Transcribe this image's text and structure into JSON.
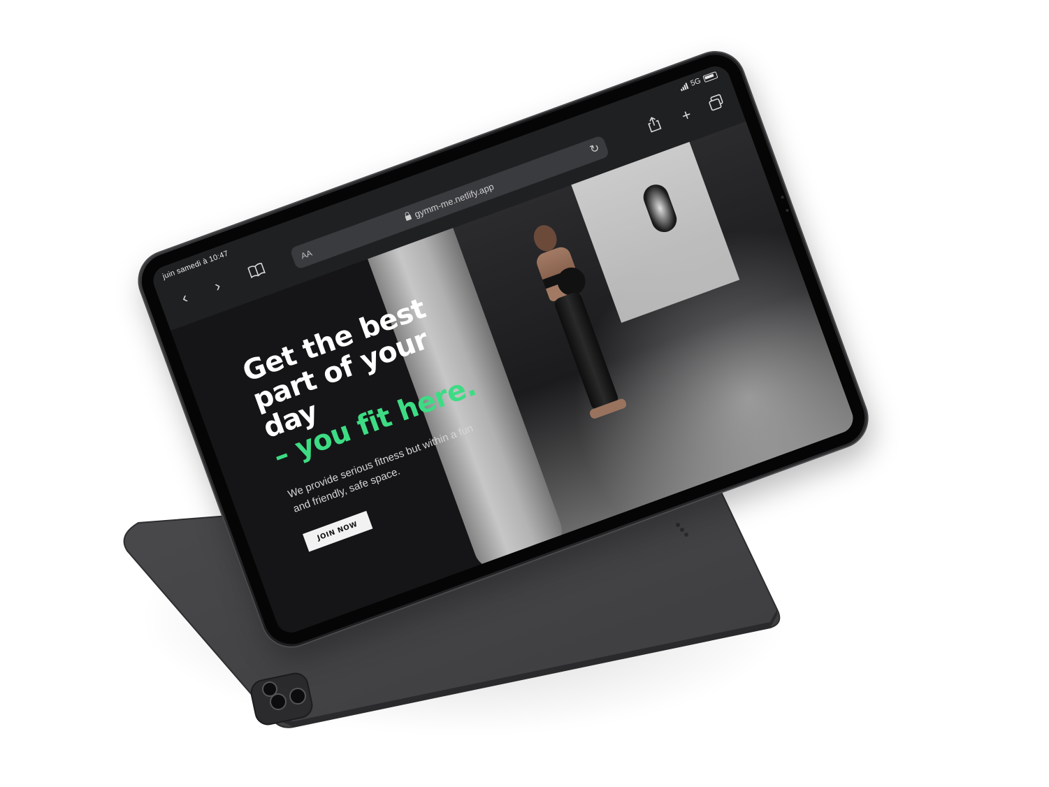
{
  "status_bar": {
    "time": "juin samedi à 10:47",
    "network": "5G"
  },
  "browser": {
    "text_size_label": "AA",
    "url": "gymm-me.netlify.app",
    "icons": {
      "back": "chevron-left-icon",
      "forward": "chevron-right-icon",
      "bookmarks": "book-icon",
      "reload": "reload-icon",
      "share": "share-icon",
      "new_tab": "plus-icon",
      "tabs": "tabs-icon"
    }
  },
  "hero": {
    "headline_lines": [
      "Get the best",
      "part of your",
      "day"
    ],
    "headline_accent": "– you fit here.",
    "subtitle": "We provide serious fitness but within a fun and friendly, safe space.",
    "cta_label": "JOIN NOW"
  },
  "colors": {
    "accent": "#3ddc84",
    "page_background": "#151517",
    "device_frame": "#1d1d1f"
  }
}
